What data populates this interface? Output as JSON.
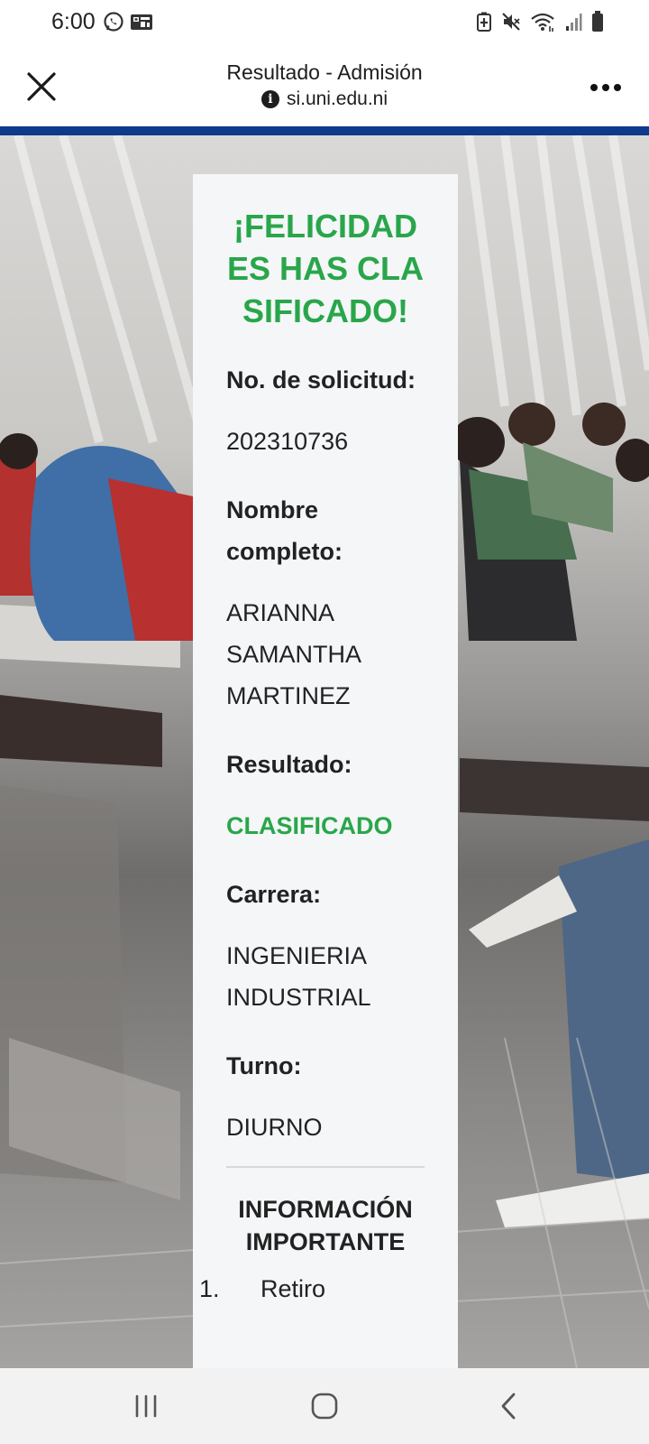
{
  "status_bar": {
    "time": "6:00",
    "left_icons": [
      "whatsapp-icon",
      "qr-icon"
    ],
    "right_icons": [
      "battery-saver-icon",
      "mute-icon",
      "wifi-icon",
      "signal-icon",
      "battery-icon"
    ]
  },
  "browser": {
    "title": "Resultado - Admisión",
    "url": "si.uni.edu.ni",
    "close_icon": "close-icon",
    "menu_icon": "more-dots-icon",
    "accent_color": "#0d3a8c"
  },
  "result_card": {
    "heading": "¡FELICIDADES HAS CLASIFICADO!",
    "request_label": "No. de solicitud:",
    "request_value": "202310736",
    "name_label": "Nombre completo:",
    "name_value": "ARIANNA SAMANTHA MARTINEZ",
    "result_label": "Resultado:",
    "result_value": "CLASIFICADO",
    "career_label": "Carrera:",
    "career_value": "INGENIERIA INDUSTRIAL",
    "shift_label": "Turno:",
    "shift_value": "DIURNO",
    "info_heading": "INFORMACIÓN IMPORTANTE",
    "info_items": [
      "Retiro"
    ],
    "success_color": "#29a64a"
  },
  "nav_bar": {
    "buttons": [
      "recent-apps-icon",
      "home-icon",
      "back-icon"
    ]
  }
}
